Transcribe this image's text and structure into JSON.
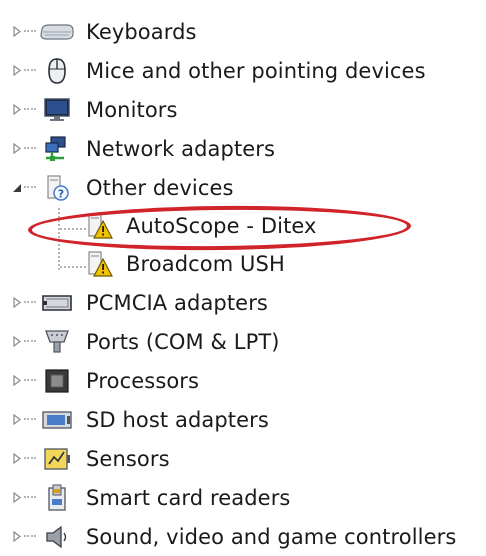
{
  "device_tree": {
    "nodes": [
      {
        "label": "Keyboards",
        "icon": "keyboard-icon",
        "expanded": false
      },
      {
        "label": "Mice and other pointing devices",
        "icon": "mouse-icon",
        "expanded": false
      },
      {
        "label": "Monitors",
        "icon": "monitor-icon",
        "expanded": false
      },
      {
        "label": "Network adapters",
        "icon": "network-adapter-icon",
        "expanded": false
      },
      {
        "label": "Other devices",
        "icon": "unknown-device-icon",
        "expanded": true,
        "children": [
          {
            "label": "AutoScope - Ditex",
            "icon": "warning-device-icon"
          },
          {
            "label": "Broadcom USH",
            "icon": "warning-device-icon"
          }
        ]
      },
      {
        "label": "PCMCIA adapters",
        "icon": "pcmcia-icon",
        "expanded": false
      },
      {
        "label": "Ports (COM & LPT)",
        "icon": "port-icon",
        "expanded": false
      },
      {
        "label": "Processors",
        "icon": "processor-icon",
        "expanded": false
      },
      {
        "label": "SD host adapters",
        "icon": "sd-adapter-icon",
        "expanded": false
      },
      {
        "label": "Sensors",
        "icon": "sensor-icon",
        "expanded": false
      },
      {
        "label": "Smart card readers",
        "icon": "smart-card-icon",
        "expanded": false
      },
      {
        "label": "Sound, video and game controllers",
        "icon": "speaker-icon",
        "expanded": false
      }
    ]
  },
  "colors": {
    "highlight": "#d0232a",
    "warning": "#f2c200",
    "tree_lines": "#b5b5b5"
  }
}
